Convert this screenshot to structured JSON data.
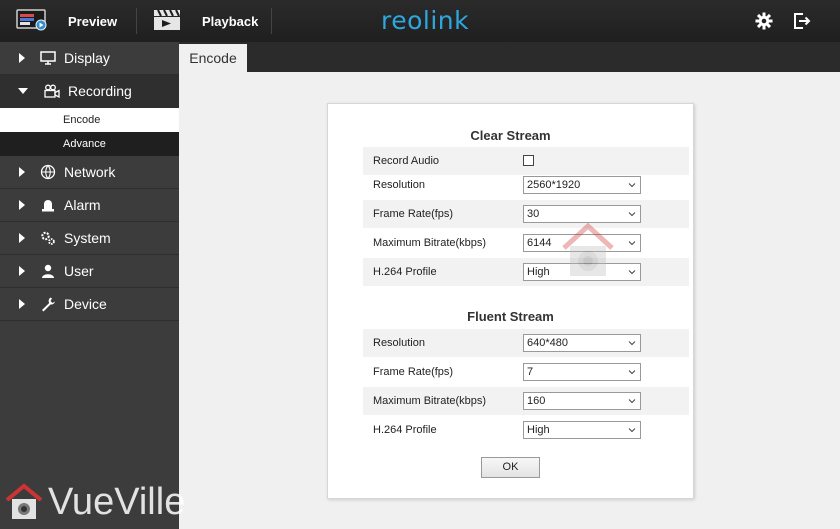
{
  "topbar": {
    "preview_label": "Preview",
    "playback_label": "Playback",
    "logo_text": "reolink",
    "accent_color": "#2ea7de",
    "icons": [
      "monitor-icon",
      "clapperboard-icon",
      "gear-icon",
      "logout-icon"
    ]
  },
  "sidebar": {
    "items": [
      {
        "label": "Display",
        "icon": "monitor-icon"
      },
      {
        "label": "Recording",
        "icon": "camcorder-icon",
        "expanded": true,
        "children": [
          {
            "label": "Encode",
            "active": true
          },
          {
            "label": "Advance"
          }
        ]
      },
      {
        "label": "Network",
        "icon": "globe-icon"
      },
      {
        "label": "Alarm",
        "icon": "siren-icon"
      },
      {
        "label": "System",
        "icon": "cogs-icon"
      },
      {
        "label": "User",
        "icon": "user-icon"
      },
      {
        "label": "Device",
        "icon": "wrench-icon"
      }
    ]
  },
  "main": {
    "tab_label": "Encode",
    "clear_stream": {
      "title": "Clear Stream",
      "record_audio_label": "Record Audio",
      "record_audio_checked": false,
      "resolution_label": "Resolution",
      "resolution_value": "2560*1920",
      "frame_rate_label": "Frame Rate(fps)",
      "frame_rate_value": "30",
      "max_bitrate_label": "Maximum Bitrate(kbps)",
      "max_bitrate_value": "6144",
      "h264_label": "H.264 Profile",
      "h264_value": "High"
    },
    "fluent_stream": {
      "title": "Fluent Stream",
      "resolution_label": "Resolution",
      "resolution_value": "640*480",
      "frame_rate_label": "Frame Rate(fps)",
      "frame_rate_value": "7",
      "max_bitrate_label": "Maximum Bitrate(kbps)",
      "max_bitrate_value": "160",
      "h264_label": "H.264 Profile",
      "h264_value": "High"
    },
    "ok_label": "OK"
  },
  "watermark": {
    "text": "VueVille"
  }
}
